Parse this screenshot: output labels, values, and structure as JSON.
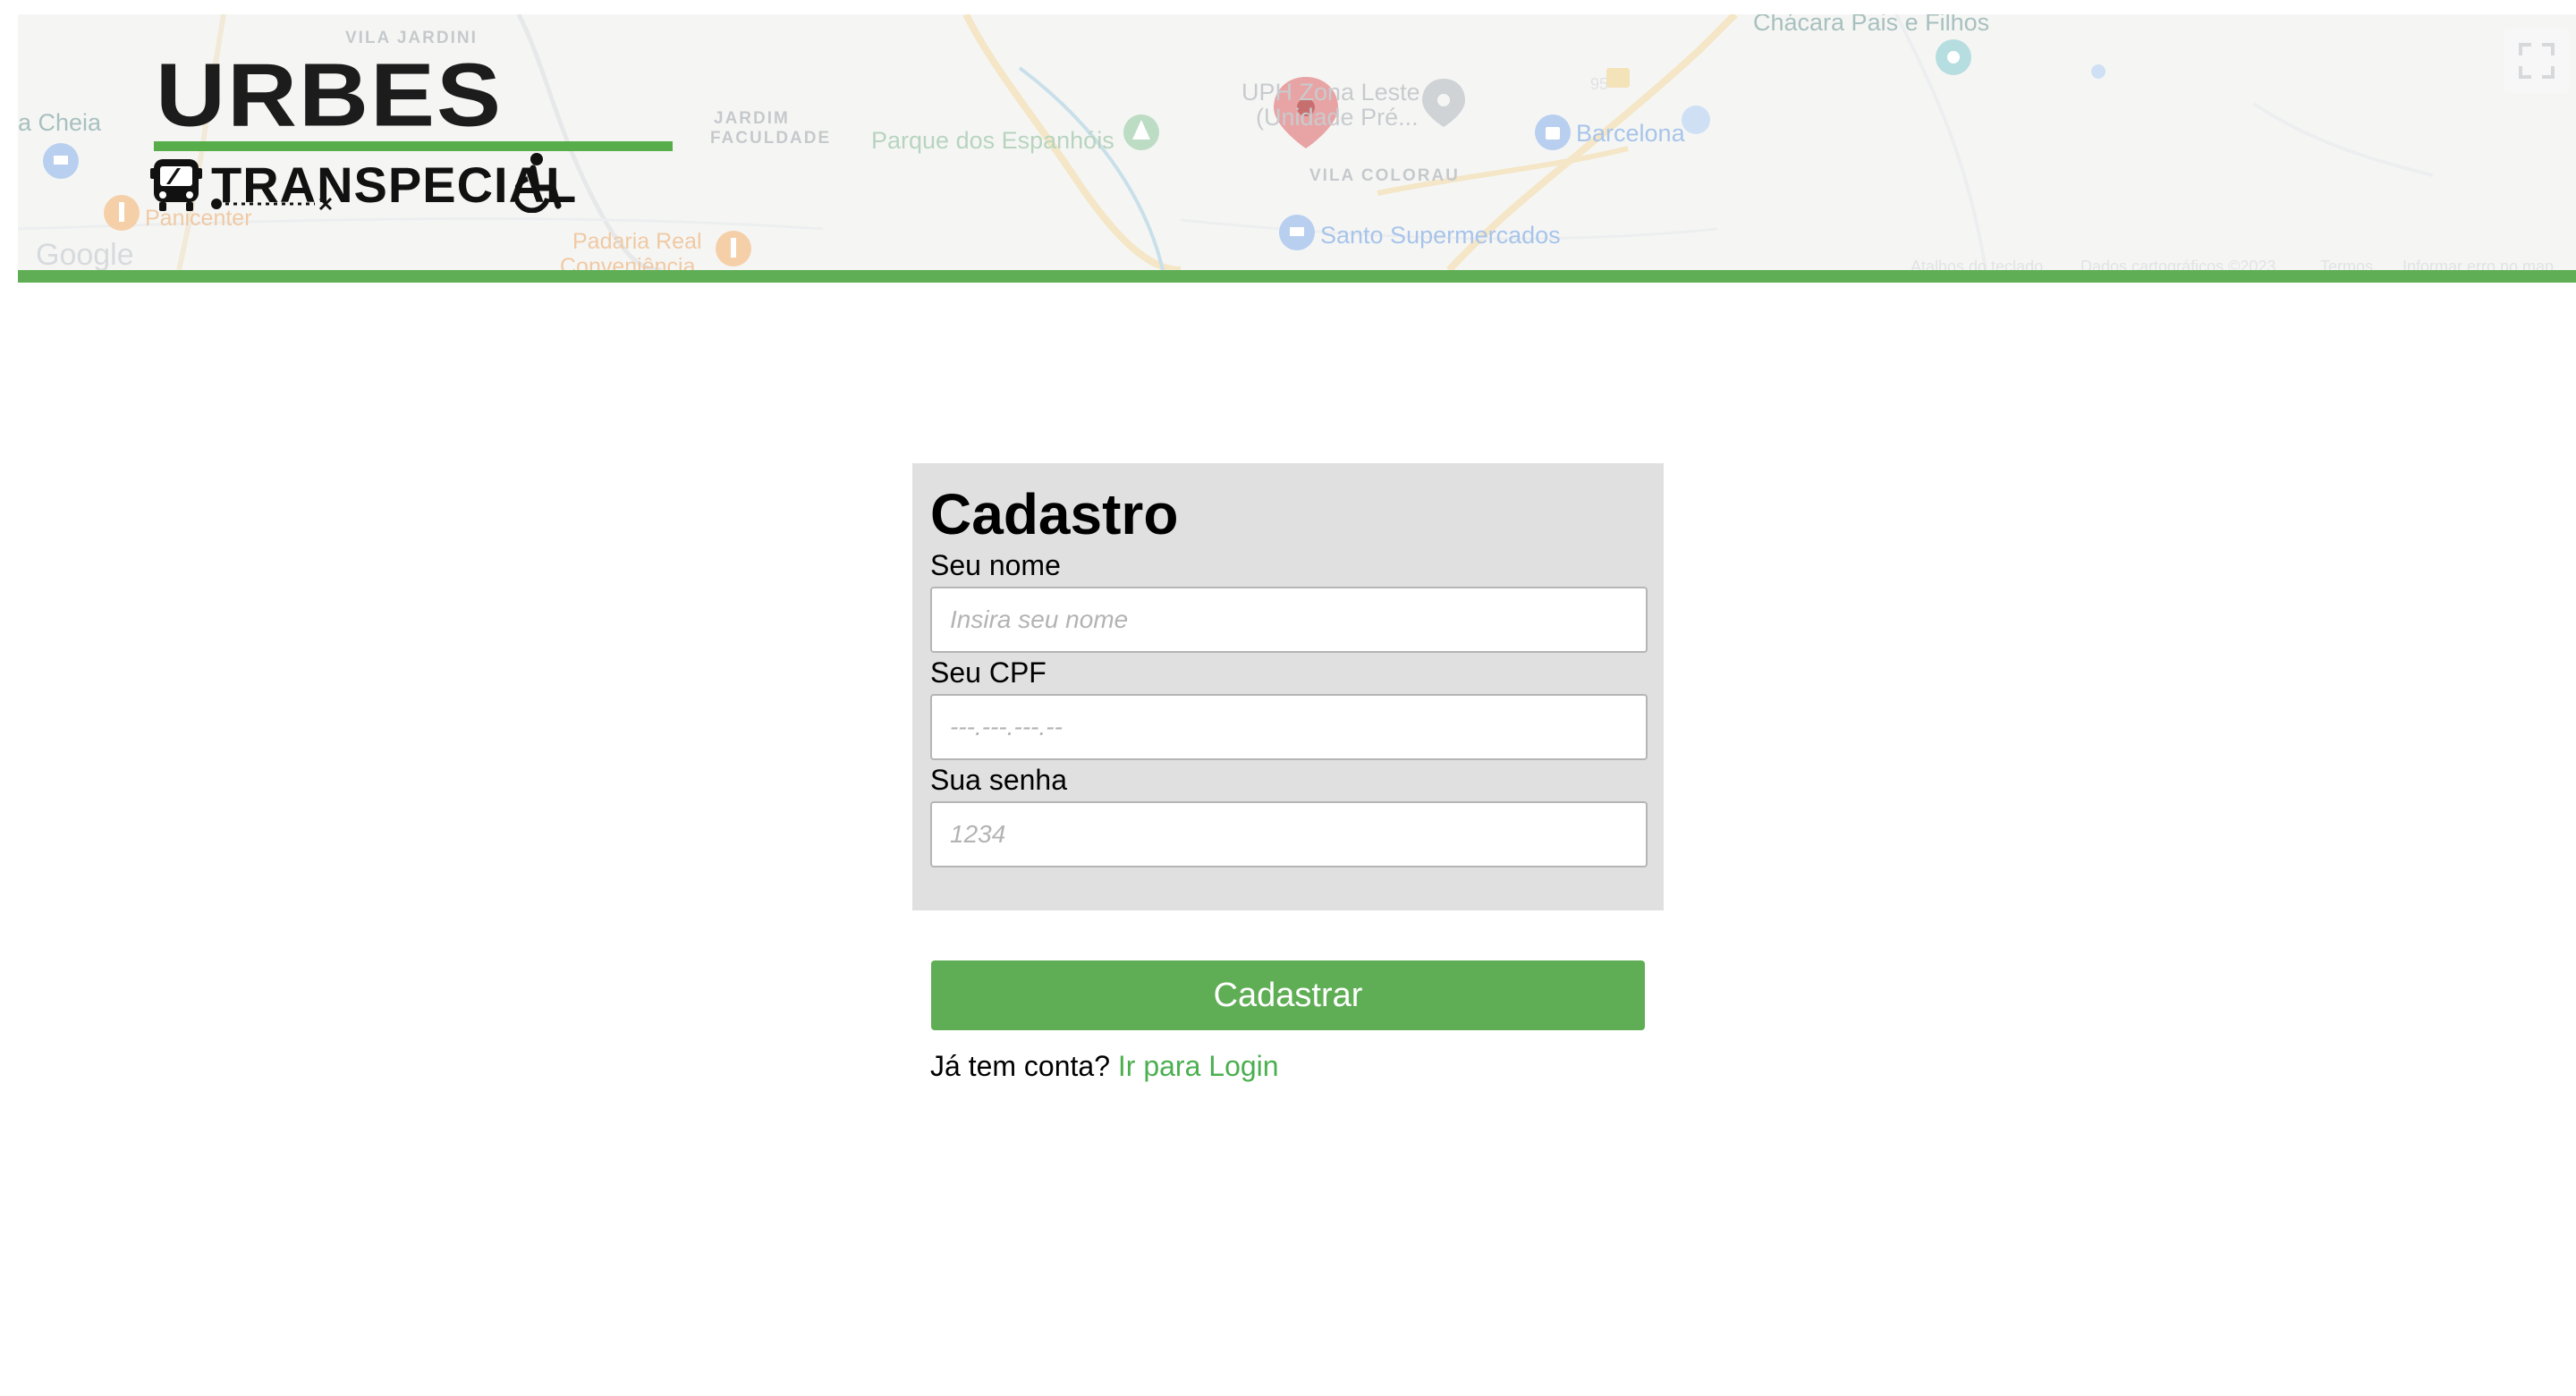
{
  "header": {
    "logo": {
      "title": "URBES",
      "subtitle": "TRANSPECIAL"
    },
    "map": {
      "labels": {
        "chacara": "Chácara Pais e Filhos",
        "vila_jardini": "VILA JARDINI",
        "a_cheia": "a Cheia",
        "jardim_faculdade_1": "JARDIM",
        "jardim_faculdade_2": "FACULDADE",
        "parque": "Parque dos Espanhóis",
        "uph_1": "UPH Zona Leste",
        "uph_2": "(Unidade Pré...",
        "barcelona": "Barcelona",
        "vila_colorau": "VILA COLORAU",
        "panicenter": "Panicenter",
        "padaria_1": "Padaria Real",
        "padaria_2": "Conveniência",
        "santo": "Santo Supermercados",
        "google": "Google",
        "road_number": "95"
      },
      "footer": {
        "shortcuts": "Atalhos do teclado",
        "map_data": "Dados cartográficos ©2023",
        "terms": "Termos",
        "report": "Informar erro no map"
      },
      "fullscreen_icon": "fullscreen-icon"
    }
  },
  "form": {
    "title": "Cadastro",
    "name": {
      "label": "Seu nome",
      "placeholder": "Insira seu nome"
    },
    "cpf": {
      "label": "Seu CPF",
      "placeholder": "---.---.---.--"
    },
    "password": {
      "label": "Sua senha",
      "placeholder": "1234"
    },
    "submit_label": "Cadastrar",
    "login_prompt": "Já tem conta?",
    "login_link": "Ir para Login"
  },
  "colors": {
    "accent": "#5fae55",
    "card_bg": "#e0e0e0",
    "link": "#4caf50"
  }
}
